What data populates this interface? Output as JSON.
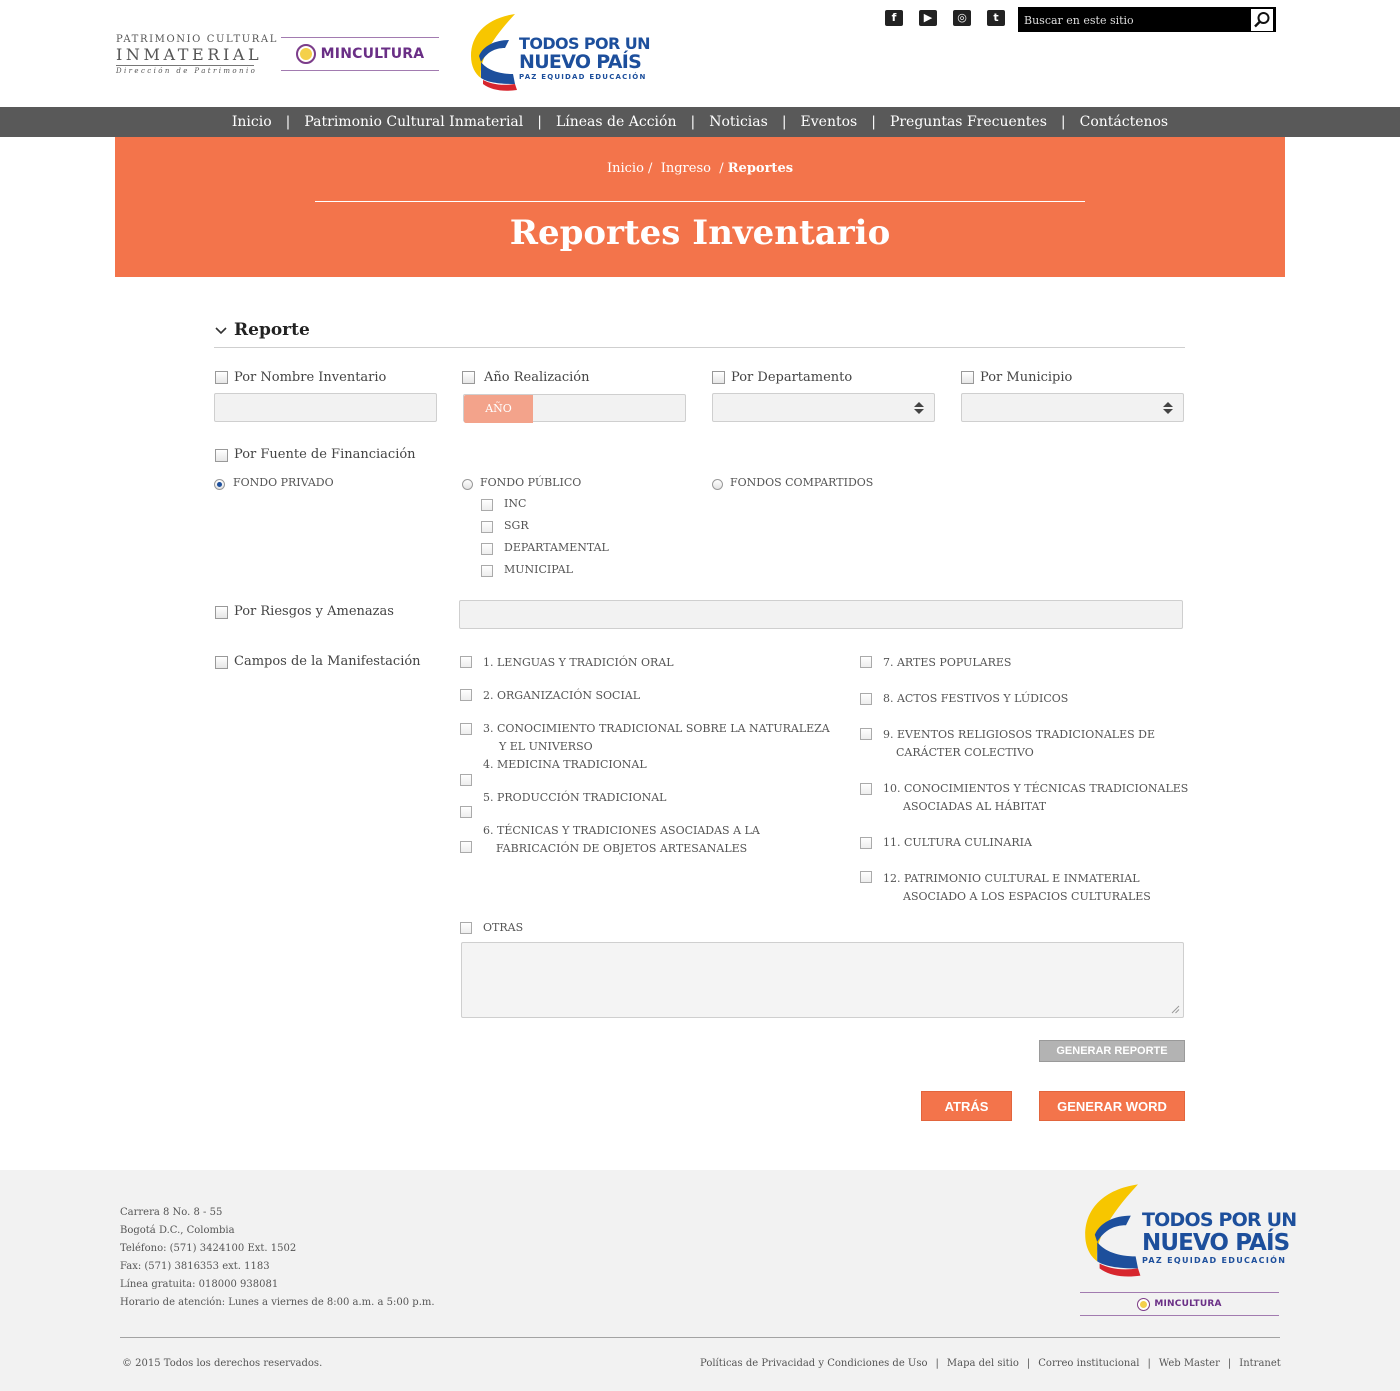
{
  "header": {
    "pci_logo": {
      "line1": "PATRIMONIO CULTURAL",
      "line2": "INMATERIAL",
      "line3": "Dirección de Patrimonio"
    },
    "ministry_logo": "MINCULTURA",
    "gov_logo": {
      "line1": "TODOS POR UN",
      "line2": "NUEVO PAÍS",
      "line3": "PAZ  EQUIDAD  EDUCACIÓN"
    },
    "social_icons": [
      "facebook-icon",
      "youtube-icon",
      "instagram-icon",
      "twitter-icon"
    ],
    "search_placeholder": "Buscar en este sitio"
  },
  "nav": {
    "items": [
      "Inicio",
      "Patrimonio Cultural Inmaterial",
      "Líneas de Acción",
      "Noticias",
      "Eventos",
      "Preguntas Frecuentes",
      "Contáctenos"
    ],
    "separator": "|"
  },
  "banner": {
    "breadcrumb": [
      "Inicio",
      "Ingreso",
      "Reportes"
    ],
    "breadcrumb_sep": "/",
    "title": "Reportes Inventario"
  },
  "form": {
    "section_title": "Reporte",
    "filters": {
      "by_name": "Por Nombre Inventario",
      "by_year": "Año Realización",
      "year_tag": "AÑO",
      "by_department": "Por Departamento",
      "by_municipality": "Por Municipio"
    },
    "funding": {
      "label": "Por Fuente de Financiación",
      "private": "FONDO PRIVADO",
      "public": "FONDO PÚBLICO",
      "shared": "FONDOS COMPARTIDOS",
      "selected": "private",
      "public_options": [
        "INC",
        "SGR",
        "DEPARTAMENTAL",
        "MUNICIPAL"
      ]
    },
    "risks_label": "Por Riesgos y Amenazas",
    "fields": {
      "label": "Campos de la Manifestación",
      "left": [
        [
          "1. LENGUAS Y TRADICIÓN ORAL"
        ],
        [
          "2. ORGANIZACIÓN SOCIAL"
        ],
        [
          "3. CONOCIMIENTO TRADICIONAL SOBRE LA NATURALEZA",
          "Y EL UNIVERSO"
        ],
        [
          "4. MEDICINA TRADICIONAL"
        ],
        [
          "5. PRODUCCIÓN TRADICIONAL"
        ],
        [
          "6. TÉCNICAS Y TRADICIONES ASOCIADAS A LA",
          "FABRICACIÓN DE OBJETOS ARTESANALES"
        ]
      ],
      "right": [
        [
          "7. ARTES POPULARES"
        ],
        [
          "8. ACTOS FESTIVOS Y LÚDICOS"
        ],
        [
          "9. EVENTOS RELIGIOSOS TRADICIONALES DE",
          "CARÁCTER COLECTIVO"
        ],
        [
          "10. CONOCIMIENTOS Y TÉCNICAS TRADICIONALES",
          "ASOCIADAS AL HÁBITAT"
        ],
        [
          "11. CULTURA CULINARIA"
        ],
        [
          "12. PATRIMONIO CULTURAL E INMATERIAL",
          "ASOCIADO A LOS ESPACIOS CULTURALES"
        ]
      ],
      "other": "OTRAS"
    },
    "buttons": {
      "generate_report": "GENERAR REPORTE",
      "back": "ATRÁS",
      "generate_word": "GENERAR WORD"
    }
  },
  "footer": {
    "address": [
      "Carrera 8 No. 8 - 55",
      "Bogotá D.C., Colombia",
      "Teléfono: (571) 3424100 Ext. 1502",
      "Fax: (571) 3816353 ext. 1183",
      "Línea gratuita: 018000 938081",
      "Horario de atención: Lunes a viernes de 8:00 a.m. a 5:00 p.m."
    ],
    "copyright": "© 2015 Todos los derechos reservados.",
    "links": [
      "Políticas de Privacidad y Condiciones de Uso",
      "Mapa del sitio",
      "Correo institucional",
      "Web Master",
      "Intranet"
    ],
    "gov_logo": {
      "line1": "TODOS POR UN",
      "line2": "NUEVO PAÍS",
      "line3": "PAZ  EQUIDAD  EDUCACIÓN"
    },
    "ministry_logo": "MINCULTURA"
  },
  "colors": {
    "accent": "#f3744b",
    "nav_bg": "#595959",
    "brand_blue": "#1d4f9c",
    "ministry_purple": "#6a2f86"
  }
}
